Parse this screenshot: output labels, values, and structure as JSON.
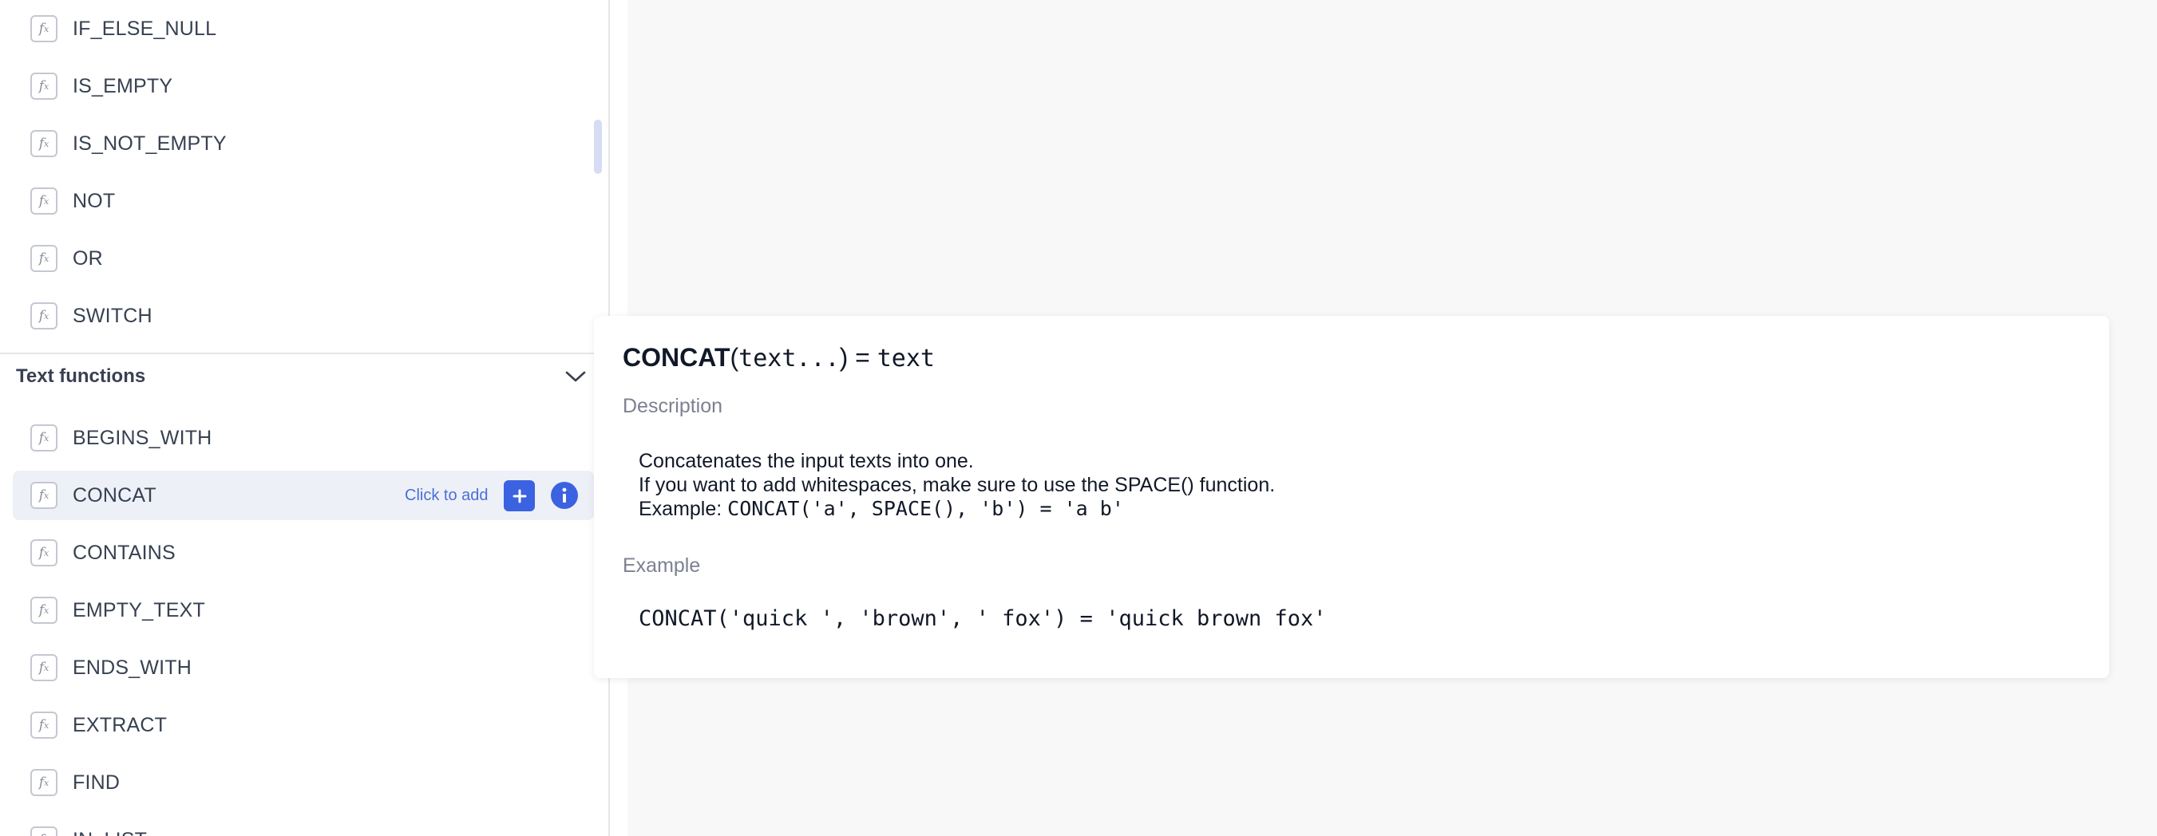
{
  "logical_functions_tail": [
    {
      "label": "IF_ELSE_NULL"
    },
    {
      "label": "IS_EMPTY"
    },
    {
      "label": "IS_NOT_EMPTY"
    },
    {
      "label": "NOT"
    },
    {
      "label": "OR"
    },
    {
      "label": "SWITCH"
    }
  ],
  "text_section": {
    "title": "Text functions",
    "items": [
      {
        "label": "BEGINS_WITH"
      },
      {
        "label": "CONCAT"
      },
      {
        "label": "CONTAINS"
      },
      {
        "label": "EMPTY_TEXT"
      },
      {
        "label": "ENDS_WITH"
      },
      {
        "label": "EXTRACT"
      },
      {
        "label": "FIND"
      },
      {
        "label": "IN_LIST"
      }
    ],
    "selected": {
      "click_to_add": "Click to add"
    }
  },
  "icons": {
    "fx": "fx",
    "plus": "plus-icon",
    "info": "info-icon",
    "chevron": "chevron-down-icon"
  },
  "popup": {
    "signature_name": "CONCAT",
    "signature_open": "(",
    "signature_args": "text...",
    "signature_close": ")",
    "signature_eq": " = ",
    "signature_return": "text",
    "description_label": "Description",
    "description_line1": "Concatenates the input texts into one.",
    "description_line2": "If you want to add whitespaces, make sure to use the SPACE() function.",
    "description_line3_prefix": "Example: ",
    "description_line3_code": "CONCAT('a', SPACE(), 'b') = 'a b'",
    "example_label": "Example",
    "example_code": "CONCAT('quick ', 'brown', ' fox') = 'quick brown fox'"
  },
  "colors": {
    "accent": "#3b62e0",
    "selected_row": "#eef0f8"
  }
}
